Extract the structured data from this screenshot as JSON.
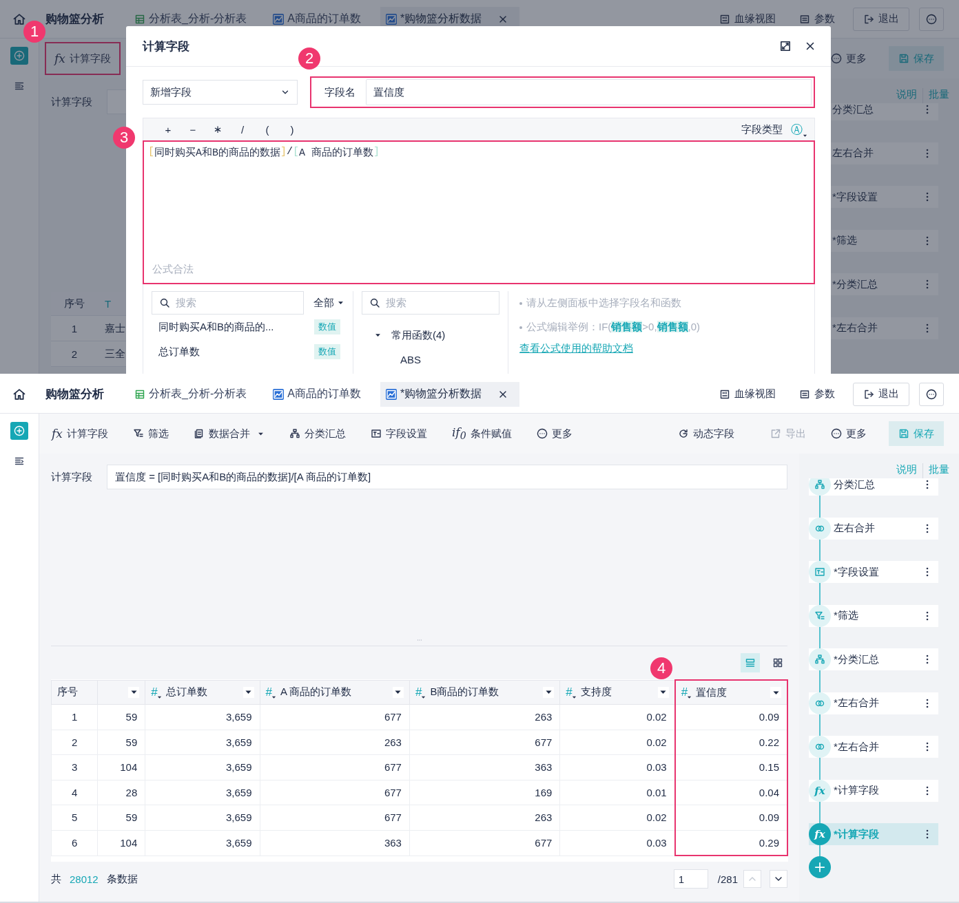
{
  "top_panel": {
    "header": {
      "title": "购物篮分析",
      "tabs": [
        {
          "label": "分析表_分析-分析表",
          "kind": "table",
          "selected": false
        },
        {
          "label": "A商品的订单数",
          "kind": "chart",
          "selected": false
        },
        {
          "label": "*购物篮分析数据",
          "kind": "chart",
          "selected": true
        }
      ],
      "actions": [
        {
          "label": "血缘视图",
          "kind": "lineage"
        },
        {
          "label": "参数",
          "kind": "params"
        },
        {
          "label": "退出",
          "kind": "exit"
        }
      ]
    },
    "toolbar_left": [
      {
        "label": "计算字段",
        "kind": "fx",
        "glyph": "fx",
        "highlighted": true
      }
    ],
    "toolbar_right": [
      {
        "label": "更多",
        "kind": "more"
      },
      {
        "label": "保存",
        "kind": "save"
      }
    ],
    "formula_label": "计算字段",
    "side_links": [
      "说明",
      "批量"
    ],
    "steps": [
      {
        "label": "分类汇总"
      },
      {
        "label": "左右合并"
      },
      {
        "label": "*字段设置"
      },
      {
        "label": "*筛选"
      },
      {
        "label": "*分类汇总"
      },
      {
        "label": "*左右合并"
      }
    ],
    "table": {
      "columns": [
        {
          "label": "序号",
          "kind": "index"
        },
        {
          "kind": "text",
          "type_glyph": "T"
        }
      ],
      "rows": [
        [
          "1",
          "嘉士"
        ],
        [
          "2",
          "三全"
        ]
      ]
    },
    "dialog": {
      "title": "计算字段",
      "mode_select": {
        "value": "新增字段"
      },
      "name_field": {
        "label": "字段名",
        "value": "置信度",
        "highlighted": true
      },
      "operators": [
        "+",
        "−",
        "∗",
        "/",
        "(",
        ")"
      ],
      "field_type": {
        "label": "字段类型",
        "glyph": "Ⓐ"
      },
      "editor": {
        "highlighted": true,
        "tokens": [
          {
            "kind": "bracket",
            "text": "[",
            "color": "#e6c36a"
          },
          {
            "kind": "field",
            "text": "同时购买A和B的商品的数据"
          },
          {
            "kind": "bracket",
            "text": "]",
            "color": "#e6c36a"
          },
          {
            "kind": "op",
            "text": "/"
          },
          {
            "kind": "bracket",
            "text": "[",
            "color": "#a6dfcf"
          },
          {
            "kind": "field",
            "text": "A 商品的订单数"
          },
          {
            "kind": "bracket",
            "text": "]",
            "color": "#a6dfcf"
          }
        ],
        "status": "公式合法"
      },
      "field_search": {
        "placeholder": "搜索"
      },
      "field_filter": "全部",
      "fields": [
        {
          "name": "同时购买A和B的商品的...",
          "type": "数值"
        },
        {
          "name": "总订单数",
          "type": "数值"
        }
      ],
      "function_search": {
        "placeholder": "搜索"
      },
      "function_tree": [
        {
          "label": "常用函数(4)",
          "expanded": true,
          "children": [
            {
              "label": "ABS"
            }
          ]
        }
      ],
      "hints": [
        "请从左侧面板中选择字段名和函数",
        "公式编辑举例：IF(**销售额**>0,**销售额**,0)"
      ],
      "help_link": "查看公式使用的帮助文档"
    },
    "callouts": [
      "1",
      "2",
      "3"
    ]
  },
  "bottom_panel": {
    "header": {
      "title": "购物篮分析",
      "tabs": [
        {
          "label": "分析表_分析-分析表",
          "kind": "table",
          "selected": false
        },
        {
          "label": "A商品的订单数",
          "kind": "chart",
          "selected": false
        },
        {
          "label": "*购物篮分析数据",
          "kind": "chart",
          "selected": true
        }
      ],
      "actions": [
        {
          "label": "血缘视图",
          "kind": "lineage"
        },
        {
          "label": "参数",
          "kind": "params"
        },
        {
          "label": "退出",
          "kind": "exit"
        }
      ]
    },
    "toolbar_left": [
      {
        "label": "计算字段",
        "kind": "fx",
        "glyph": "fx"
      },
      {
        "label": "筛选",
        "kind": "filter"
      },
      {
        "label": "数据合并",
        "kind": "merge",
        "dropdown": true
      },
      {
        "label": "分类汇总",
        "kind": "group"
      },
      {
        "label": "字段设置",
        "kind": "fields"
      },
      {
        "label": "条件赋值",
        "kind": "if",
        "glyph": "if$_{0}$"
      },
      {
        "label": "更多",
        "kind": "more"
      }
    ],
    "toolbar_right": [
      {
        "label": "动态字段",
        "kind": "dynamic"
      },
      {
        "label": "导出",
        "kind": "export",
        "disabled": true
      },
      {
        "label": "更多",
        "kind": "more"
      },
      {
        "label": "保存",
        "kind": "save"
      }
    ],
    "formula": {
      "label": "计算字段",
      "value": "置信度 = [同时购买A和B的商品的数据]/[A 商品的订单数]"
    },
    "side_links": [
      "说明",
      "批量"
    ],
    "steps": [
      {
        "label": "分类汇总",
        "kind": "group",
        "selected": false
      },
      {
        "label": "左右合并",
        "kind": "join",
        "selected": false
      },
      {
        "label": "*字段设置",
        "kind": "fields",
        "selected": false
      },
      {
        "label": "*筛选",
        "kind": "filter",
        "selected": false
      },
      {
        "label": "*分类汇总",
        "kind": "group",
        "selected": false
      },
      {
        "label": "*左右合并",
        "kind": "join",
        "selected": false
      },
      {
        "label": "*左右合并",
        "kind": "join",
        "selected": false
      },
      {
        "label": "*计算字段",
        "kind": "fx",
        "glyph": "fx",
        "selected": false
      },
      {
        "label": "*计算字段",
        "kind": "fx",
        "glyph": "fx",
        "selected": true
      }
    ],
    "views": [
      {
        "kind": "list",
        "selected": true
      },
      {
        "kind": "grid",
        "selected": false
      }
    ],
    "table": {
      "columns": [
        {
          "label": "序号",
          "kind": "index"
        },
        {
          "kind": "number"
        },
        {
          "label": "总订单数",
          "kind": "number",
          "type_glyph": "#"
        },
        {
          "label": "A 商品的订单数",
          "kind": "number",
          "type_glyph": "#"
        },
        {
          "label": "B商品的订单数",
          "kind": "number",
          "type_glyph": "#"
        },
        {
          "label": "支持度",
          "kind": "number",
          "type_glyph": "#"
        },
        {
          "label": "置信度",
          "kind": "number",
          "type_glyph": "#",
          "highlighted": true
        }
      ],
      "rows": [
        [
          "1",
          "59",
          "3,659",
          "677",
          "263",
          "0.02",
          "0.09"
        ],
        [
          "2",
          "59",
          "3,659",
          "263",
          "677",
          "0.02",
          "0.22"
        ],
        [
          "3",
          "104",
          "3,659",
          "677",
          "363",
          "0.03",
          "0.15"
        ],
        [
          "4",
          "28",
          "3,659",
          "677",
          "169",
          "0.01",
          "0.04"
        ],
        [
          "5",
          "59",
          "3,659",
          "677",
          "263",
          "0.02",
          "0.09"
        ],
        [
          "6",
          "104",
          "3,659",
          "363",
          "677",
          "0.03",
          "0.29"
        ]
      ]
    },
    "footer": {
      "prefix": "共",
      "count": "28012",
      "suffix": "条数据",
      "page": "1",
      "pages": "/281"
    },
    "callouts": [
      "4"
    ]
  }
}
